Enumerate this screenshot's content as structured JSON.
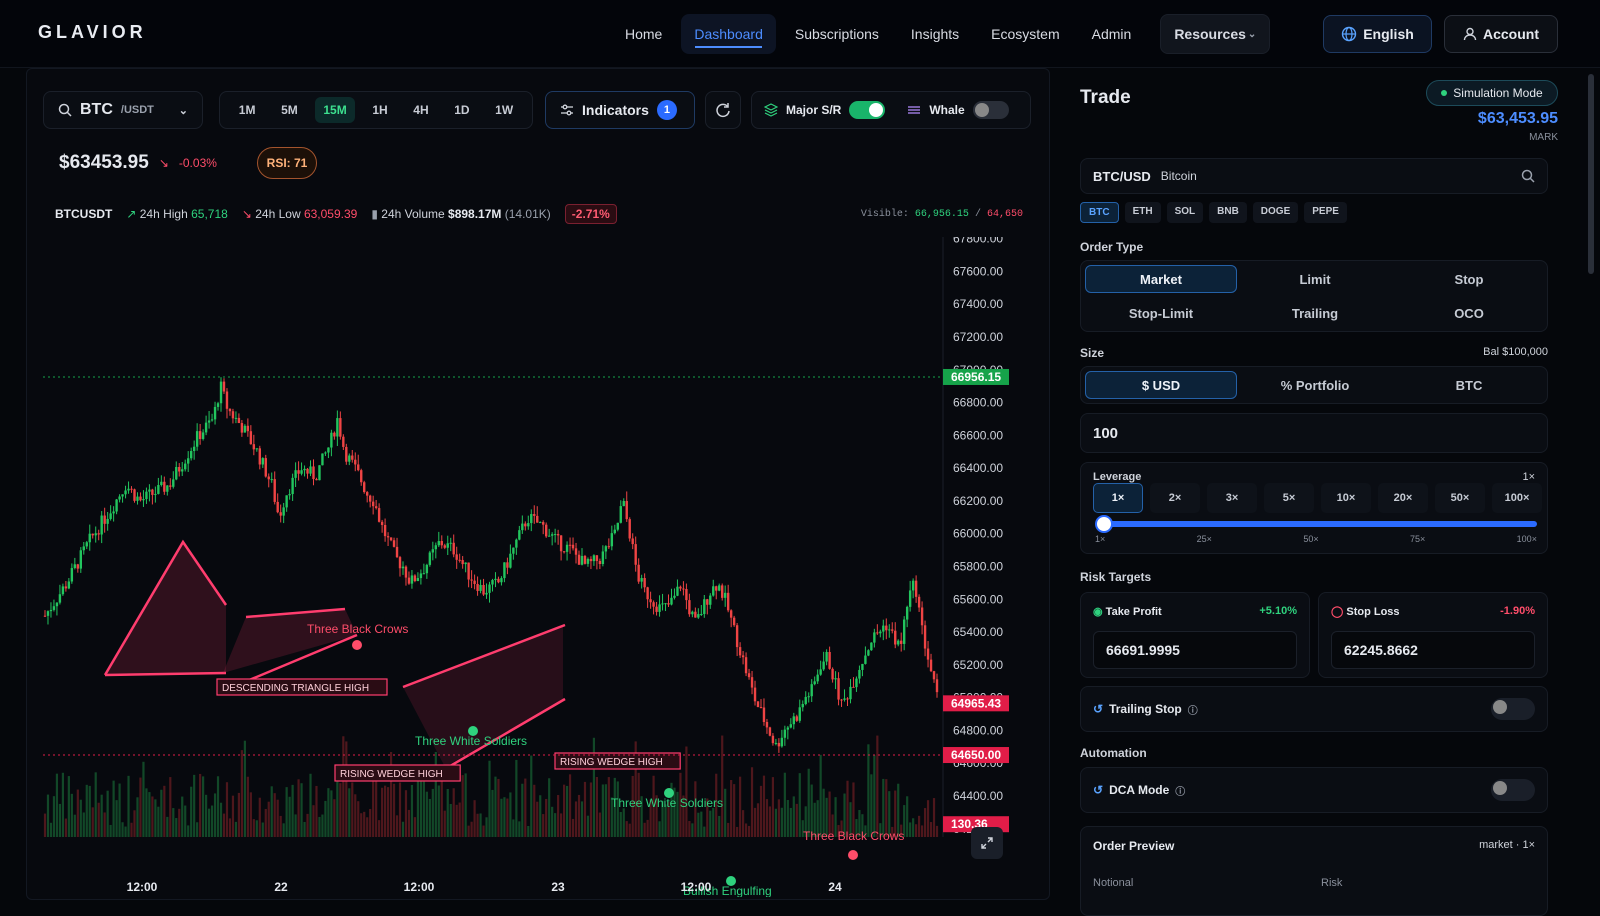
{
  "app": {
    "logo": "GLAVIOR"
  },
  "nav": {
    "items": [
      "Home",
      "Dashboard",
      "Subscriptions",
      "Insights",
      "Ecosystem",
      "Admin"
    ],
    "resources": "Resources",
    "language": "English",
    "account": "Account"
  },
  "toolbar": {
    "symbol": "BTC",
    "quote": "/USDT",
    "timeframes": [
      "1M",
      "5M",
      "15M",
      "1H",
      "4H",
      "1D",
      "1W"
    ],
    "active_timeframe": "15M",
    "indicators_label": "Indicators",
    "indicators_count": "1",
    "major_sr_label": "Major S/R",
    "major_sr_on": true,
    "whale_label": "Whale",
    "whale_on": false
  },
  "ticker": {
    "price": "$63453.95",
    "change": "-0.03%",
    "rsi": "RSI: 71"
  },
  "stats": {
    "pair": "BTCUSDT",
    "high_label": "24h High",
    "high": "65,718",
    "low_label": "24h Low",
    "low": "63,059.39",
    "volume_label": "24h Volume",
    "volume": "$898.17M",
    "volume_count": "(14.01K)",
    "change_pct": "-2.71%",
    "visible_label": "Visible:",
    "visible_high": "66,956.15",
    "visible_sep": "/",
    "visible_low": "64,650"
  },
  "chart_data": {
    "type": "candlestick",
    "y_ticks": [
      "67800.00",
      "67600.00",
      "67400.00",
      "67200.00",
      "67000.00",
      "66800.00",
      "66600.00",
      "66400.00",
      "66200.00",
      "66000.00",
      "65800.00",
      "65600.00",
      "65400.00",
      "65200.00",
      "65000.00",
      "64800.00",
      "64600.00",
      "64400.00",
      "64200.00"
    ],
    "ylim": [
      64150,
      67810
    ],
    "x_ticks": [
      "12:00",
      "22",
      "12:00",
      "23",
      "12:00",
      "24"
    ],
    "price_markers": [
      {
        "label": "66956.15",
        "value": 66956.15,
        "color": "#16a34a"
      },
      {
        "label": "64965.43",
        "value": 64965.43,
        "color": "#e11d48"
      },
      {
        "label": "64650.00",
        "value": 64650.0,
        "color": "#e11d48"
      },
      {
        "label": "130.36",
        "value": 64228,
        "color": "#e11d48"
      }
    ],
    "close_path": [
      [
        0,
        65500
      ],
      [
        6,
        65700
      ],
      [
        12,
        65950
      ],
      [
        18,
        66150
      ],
      [
        22,
        66300
      ],
      [
        26,
        66200
      ],
      [
        30,
        66250
      ],
      [
        34,
        66300
      ],
      [
        38,
        66450
      ],
      [
        42,
        66600
      ],
      [
        46,
        66700
      ],
      [
        48,
        66900
      ],
      [
        50,
        66760
      ],
      [
        54,
        66650
      ],
      [
        58,
        66500
      ],
      [
        62,
        66300
      ],
      [
        64,
        66100
      ],
      [
        66,
        66250
      ],
      [
        70,
        66400
      ],
      [
        74,
        66350
      ],
      [
        78,
        66550
      ],
      [
        80,
        66700
      ],
      [
        82,
        66500
      ],
      [
        86,
        66350
      ],
      [
        88,
        66250
      ],
      [
        90,
        66200
      ],
      [
        92,
        66050
      ],
      [
        94,
        65950
      ],
      [
        96,
        65850
      ],
      [
        98,
        65800
      ],
      [
        100,
        65700
      ],
      [
        104,
        65800
      ],
      [
        108,
        65950
      ],
      [
        112,
        65900
      ],
      [
        116,
        65750
      ],
      [
        120,
        65650
      ],
      [
        124,
        65700
      ],
      [
        128,
        65900
      ],
      [
        132,
        66100
      ],
      [
        136,
        66050
      ],
      [
        140,
        65950
      ],
      [
        144,
        65900
      ],
      [
        148,
        65800
      ],
      [
        152,
        65850
      ],
      [
        156,
        66000
      ],
      [
        158,
        66200
      ],
      [
        160,
        66000
      ],
      [
        162,
        65750
      ],
      [
        164,
        65650
      ],
      [
        166,
        65600
      ],
      [
        168,
        65550
      ],
      [
        170,
        65550
      ],
      [
        172,
        65600
      ],
      [
        174,
        65700
      ],
      [
        176,
        65550
      ],
      [
        178,
        65450
      ],
      [
        180,
        65550
      ],
      [
        182,
        65650
      ],
      [
        184,
        65700
      ],
      [
        186,
        65600
      ],
      [
        188,
        65450
      ],
      [
        190,
        65300
      ],
      [
        192,
        65150
      ],
      [
        194,
        65000
      ],
      [
        196,
        64900
      ],
      [
        198,
        64800
      ],
      [
        200,
        64700
      ],
      [
        202,
        64800
      ],
      [
        204,
        64850
      ],
      [
        206,
        64900
      ],
      [
        208,
        65000
      ],
      [
        210,
        65050
      ],
      [
        212,
        65200
      ],
      [
        214,
        65250
      ],
      [
        216,
        65100
      ],
      [
        218,
        64950
      ],
      [
        220,
        65050
      ],
      [
        222,
        65150
      ],
      [
        226,
        65350
      ],
      [
        230,
        65450
      ],
      [
        234,
        65300
      ],
      [
        236,
        65600
      ],
      [
        238,
        65700
      ],
      [
        240,
        65400
      ],
      [
        242,
        65200
      ],
      [
        244,
        65000
      ]
    ],
    "patterns": [
      {
        "label": "DESCENDING TRIANGLE  HIGH",
        "kind": "box"
      },
      {
        "label": "RISING WEDGE  HIGH",
        "kind": "box"
      },
      {
        "label": "RISING WEDGE  HIGH",
        "kind": "box"
      },
      {
        "label": "Three Black Crows",
        "kind": "bear"
      },
      {
        "label": "Three White Soldiers",
        "kind": "bull"
      },
      {
        "label": "Three White Soldiers",
        "kind": "bull"
      },
      {
        "label": "Bullish Engulfing",
        "kind": "bull"
      },
      {
        "label": "Three Black Crows",
        "kind": "bear"
      }
    ]
  },
  "trade": {
    "title": "Trade",
    "mode": "Simulation Mode",
    "mark_price": "$63,453.95",
    "mark_label": "MARK",
    "pair": "BTC/USD",
    "coin_name": "Bitcoin",
    "coins": [
      "BTC",
      "ETH",
      "SOL",
      "BNB",
      "DOGE",
      "PEPE"
    ],
    "order_type_label": "Order Type",
    "order_types": [
      "Market",
      "Limit",
      "Stop",
      "Stop-Limit",
      "Trailing",
      "OCO"
    ],
    "size_label": "Size",
    "balance": "Bal $100,000",
    "size_modes": [
      "$  USD",
      "%  Portfolio",
      "BTC"
    ],
    "size_value": "100",
    "leverage_label": "Leverage",
    "leverage_value": "1×",
    "leverage_options": [
      "1×",
      "2×",
      "3×",
      "5×",
      "10×",
      "20×",
      "50×",
      "100×"
    ],
    "leverage_scale": [
      "1×",
      "25×",
      "50×",
      "75×",
      "100×"
    ],
    "risk_label": "Risk Targets",
    "tp_label": "Take Profit",
    "tp_pct": "+5.10%",
    "tp_value": "66691.9995",
    "sl_label": "Stop Loss",
    "sl_pct": "-1.90%",
    "sl_value": "62245.8662",
    "trailing_label": "Trailing Stop",
    "automation_label": "Automation",
    "dca_label": "DCA Mode",
    "preview_label": "Order Preview",
    "preview_meta": "market · 1×",
    "notional_label": "Notional",
    "risk_col_label": "Risk"
  }
}
